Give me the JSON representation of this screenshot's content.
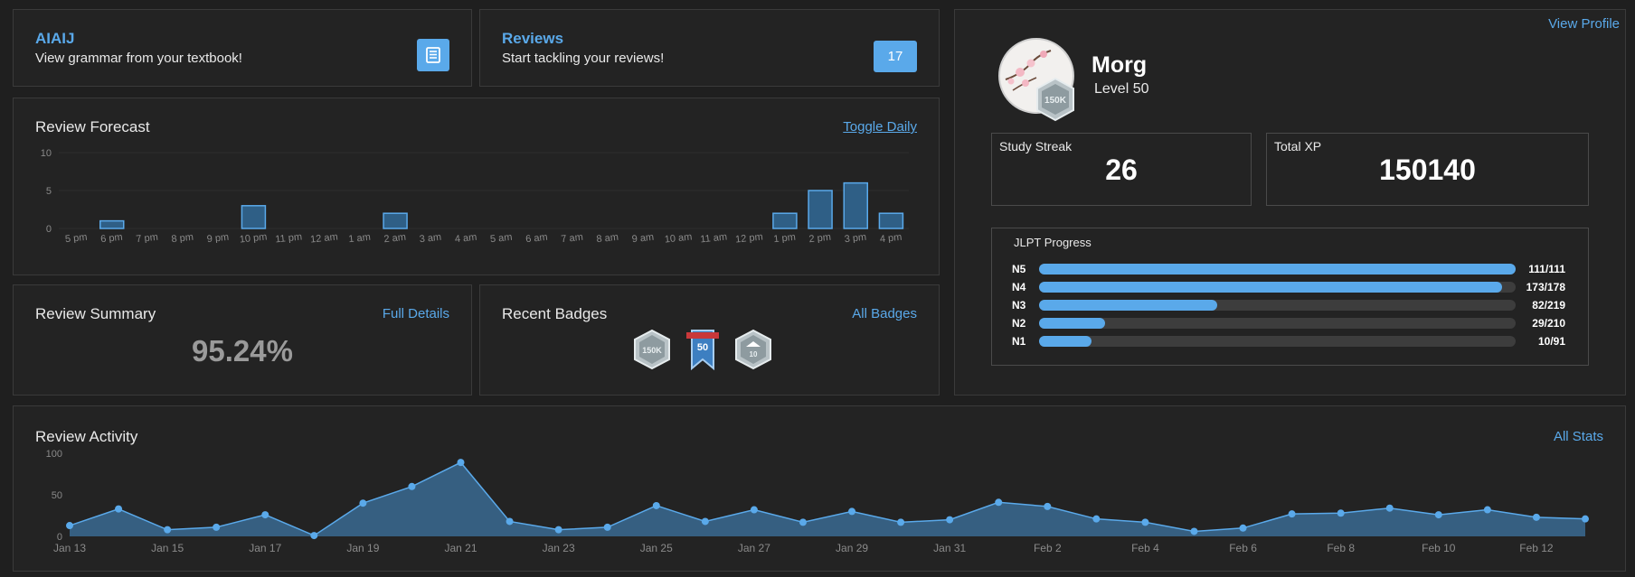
{
  "grammar_card": {
    "title": "AIAIJ",
    "subtitle": "View grammar from your textbook!",
    "icon": "book-icon"
  },
  "reviews_card": {
    "title": "Reviews",
    "subtitle": "Start tackling your reviews!",
    "count": "17"
  },
  "profile": {
    "view_profile_label": "View Profile",
    "username": "Morg",
    "level_text": "Level 50",
    "avatar_badge_text": "150K",
    "study_streak_label": "Study Streak",
    "study_streak_value": "26",
    "total_xp_label": "Total XP",
    "total_xp_value": "150140"
  },
  "jlpt": {
    "title": "JLPT Progress",
    "levels": [
      {
        "label": "N5",
        "done": 111,
        "total": 111,
        "text": "111/111"
      },
      {
        "label": "N4",
        "done": 173,
        "total": 178,
        "text": "173/178"
      },
      {
        "label": "N3",
        "done": 82,
        "total": 219,
        "text": "82/219"
      },
      {
        "label": "N2",
        "done": 29,
        "total": 210,
        "text": "29/210"
      },
      {
        "label": "N1",
        "done": 10,
        "total": 91,
        "text": "10/91"
      }
    ]
  },
  "forecast": {
    "title": "Review Forecast",
    "toggle_label": "Toggle Daily"
  },
  "summary": {
    "title": "Review Summary",
    "link_label": "Full Details",
    "percentage": "95.24%"
  },
  "badges": {
    "title": "Recent Badges",
    "link_label": "All Badges",
    "items": [
      "150K",
      "50",
      "10"
    ]
  },
  "activity": {
    "title": "Review Activity",
    "link_label": "All Stats"
  },
  "colors": {
    "accent": "#5aa9ea",
    "bar_fill": "#2f5f86",
    "panel": "#232323",
    "background": "#1f1f1f"
  },
  "chart_data": [
    {
      "type": "bar",
      "title": "Review Forecast",
      "categories": [
        "5 pm",
        "6 pm",
        "7 pm",
        "8 pm",
        "9 pm",
        "10 pm",
        "11 pm",
        "12 am",
        "1 am",
        "2 am",
        "3 am",
        "4 am",
        "5 am",
        "6 am",
        "7 am",
        "8 am",
        "9 am",
        "10 am",
        "11 am",
        "12 pm",
        "1 pm",
        "2 pm",
        "3 pm",
        "4 pm"
      ],
      "values": [
        0,
        1,
        0,
        0,
        0,
        3,
        0,
        0,
        0,
        2,
        0,
        0,
        0,
        0,
        0,
        0,
        0,
        0,
        0,
        0,
        2,
        5,
        6,
        2
      ],
      "ylim": [
        0,
        10
      ],
      "yticks": [
        0,
        5,
        10
      ]
    },
    {
      "type": "area",
      "title": "Review Activity",
      "x": [
        "Jan 13",
        "Jan 14",
        "Jan 15",
        "Jan 16",
        "Jan 17",
        "Jan 18",
        "Jan 19",
        "Jan 20",
        "Jan 21",
        "Jan 22",
        "Jan 23",
        "Jan 24",
        "Jan 25",
        "Jan 26",
        "Jan 27",
        "Jan 28",
        "Jan 29",
        "Jan 30",
        "Jan 31",
        "Feb 1",
        "Feb 2",
        "Feb 3",
        "Feb 4",
        "Feb 5",
        "Feb 6",
        "Feb 7",
        "Feb 8",
        "Feb 9",
        "Feb 10",
        "Feb 11",
        "Feb 12",
        "Feb 13"
      ],
      "values": [
        13,
        33,
        8,
        11,
        26,
        1,
        40,
        60,
        89,
        18,
        8,
        11,
        37,
        18,
        32,
        17,
        30,
        17,
        20,
        41,
        36,
        21,
        17,
        6,
        10,
        27,
        28,
        34,
        26,
        32,
        23,
        21
      ],
      "xtick_labels": [
        "Jan 13",
        "Jan 15",
        "Jan 17",
        "Jan 19",
        "Jan 21",
        "Jan 23",
        "Jan 25",
        "Jan 27",
        "Jan 29",
        "Jan 31",
        "Feb 2",
        "Feb 4",
        "Feb 6",
        "Feb 8",
        "Feb 10",
        "Feb 12"
      ],
      "ylim": [
        0,
        100
      ],
      "yticks": [
        0,
        50,
        100
      ]
    }
  ]
}
